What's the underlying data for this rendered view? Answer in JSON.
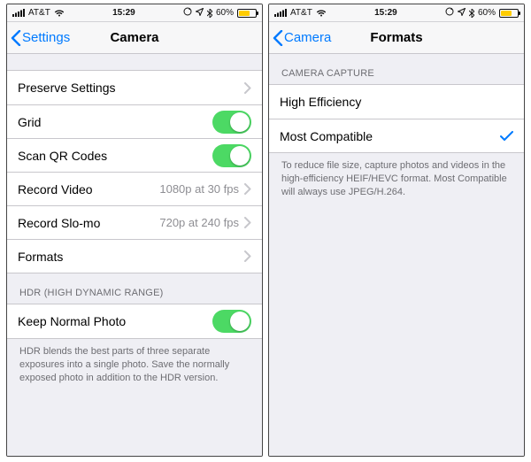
{
  "statusbar": {
    "carrier": "AT&T",
    "time": "15:29",
    "battery_pct": "60%"
  },
  "left": {
    "back": "Settings",
    "title": "Camera",
    "rows": {
      "preserve": "Preserve Settings",
      "grid": "Grid",
      "qr": "Scan QR Codes",
      "record_video": "Record Video",
      "record_video_detail": "1080p at 30 fps",
      "slomo": "Record Slo-mo",
      "slomo_detail": "720p at 240 fps",
      "formats": "Formats"
    },
    "hdr_header": "HDR (HIGH DYNAMIC RANGE)",
    "keep_normal": "Keep Normal Photo",
    "hdr_footer": "HDR blends the best parts of three separate exposures into a single photo. Save the normally exposed photo in addition to the HDR version."
  },
  "right": {
    "back": "Camera",
    "title": "Formats",
    "header": "CAMERA CAPTURE",
    "high_eff": "High Efficiency",
    "most_compat": "Most Compatible",
    "footer": "To reduce file size, capture photos and videos in the high-efficiency HEIF/HEVC format. Most Compatible will always use JPEG/H.264."
  },
  "toggles": {
    "grid": true,
    "qr": true,
    "keep_normal": true
  }
}
